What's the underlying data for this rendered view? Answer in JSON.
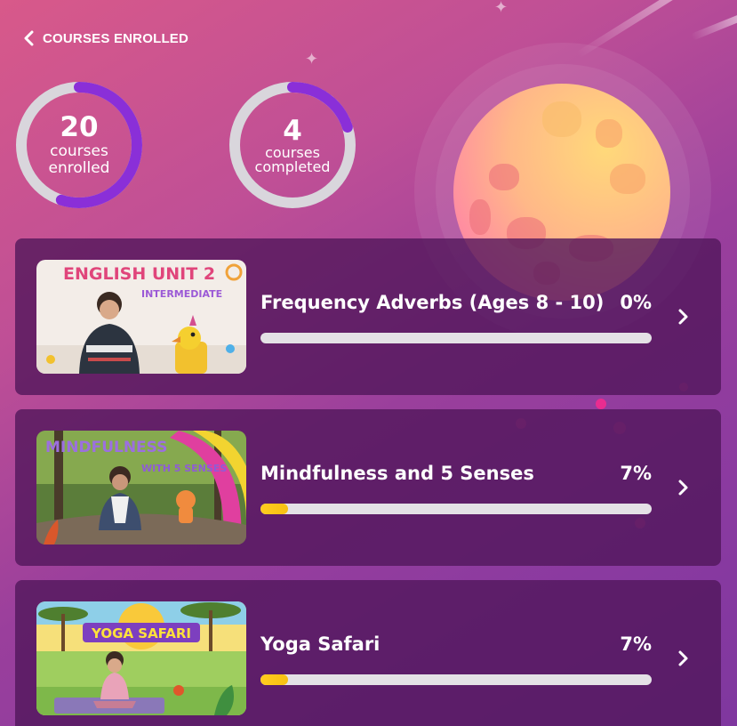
{
  "header": {
    "title": "COURSES ENROLLED",
    "back_icon": "chevron-left-icon"
  },
  "stats": {
    "enrolled": {
      "value": "20",
      "label_line1": "courses",
      "label_line2": "enrolled",
      "ring_fraction": 0.55
    },
    "completed": {
      "value": "4",
      "label_line1": "courses",
      "label_line2": "completed",
      "ring_fraction": 0.2
    }
  },
  "colors": {
    "ring_track": "#d9d6dc",
    "ring_fill": "#8a2fd8",
    "progress_fill": "#ffcc1f"
  },
  "courses": [
    {
      "title": "Frequency Adverbs (Ages 8 - 10)",
      "percent": "0%",
      "progress": 0.0,
      "thumbnail": {
        "title": "ENGLISH UNIT 2",
        "subtitle": "INTERMEDIATE"
      }
    },
    {
      "title": "Mindfulness and 5 Senses",
      "percent": "7%",
      "progress": 0.07,
      "thumbnail": {
        "title": "MINDFULNESS",
        "subtitle": "WITH 5 SENSES"
      }
    },
    {
      "title": "Yoga Safari",
      "percent": "7%",
      "progress": 0.07,
      "thumbnail": {
        "title": "YOGA SAFARI",
        "subtitle": ""
      }
    }
  ]
}
